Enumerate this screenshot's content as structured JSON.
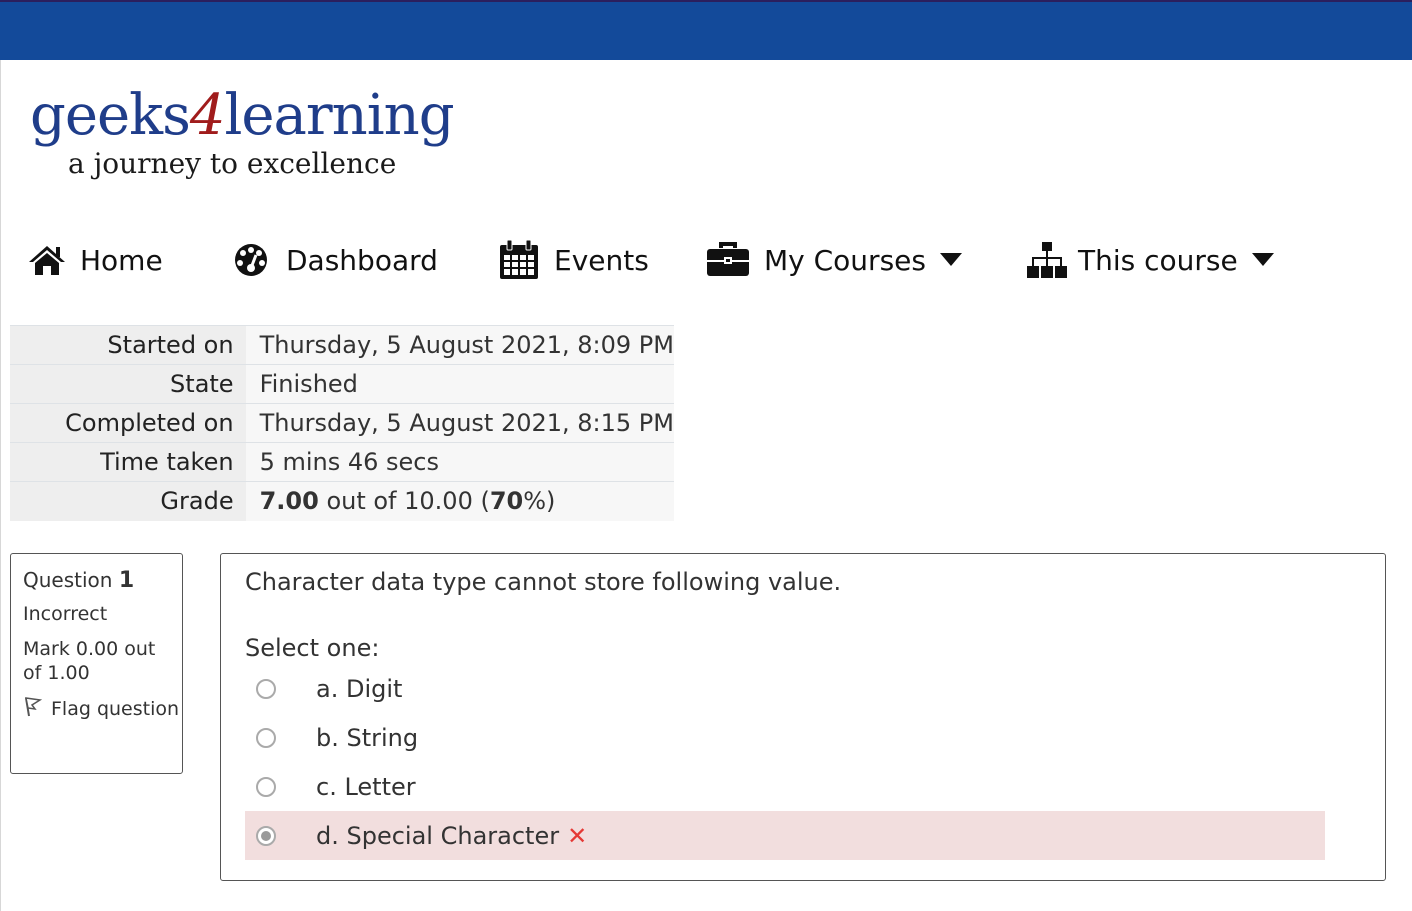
{
  "header": {
    "bar_color": "#134a9a"
  },
  "logo": {
    "brand_prefix": "geeks",
    "brand_four": "4",
    "brand_suffix": "learning",
    "tagline": "a journey to excellence"
  },
  "nav": {
    "home": {
      "label": "Home",
      "icon": "home-icon"
    },
    "dashboard": {
      "label": "Dashboard",
      "icon": "dashboard-icon"
    },
    "events": {
      "label": "Events",
      "icon": "calendar-icon"
    },
    "my_courses": {
      "label": "My Courses",
      "icon": "briefcase-icon"
    },
    "this_course": {
      "label": "This course",
      "icon": "sitemap-icon"
    }
  },
  "summary": {
    "rows": [
      {
        "label": "Started on",
        "value": "Thursday, 5 August 2021, 8:09 PM"
      },
      {
        "label": "State",
        "value": "Finished"
      },
      {
        "label": "Completed on",
        "value": "Thursday, 5 August 2021, 8:15 PM"
      },
      {
        "label": "Time taken",
        "value": "5 mins 46 secs"
      }
    ],
    "grade": {
      "label": "Grade",
      "score": "7.00",
      "middle": "out of 10.00 (",
      "percent": "70",
      "end": "%)"
    }
  },
  "question": {
    "label": "Question",
    "number": "1",
    "state": "Incorrect",
    "mark": "Mark 0.00 out of 1.00",
    "flag": "Flag question",
    "text": "Character data type cannot store following value.",
    "prompt": "Select one:",
    "options": [
      {
        "label": "a. Digit",
        "selected": false
      },
      {
        "label": "b. String",
        "selected": false
      },
      {
        "label": "c. Letter",
        "selected": false
      },
      {
        "label": "d. Special Character",
        "selected": true,
        "incorrect_mark": "✕"
      }
    ]
  }
}
